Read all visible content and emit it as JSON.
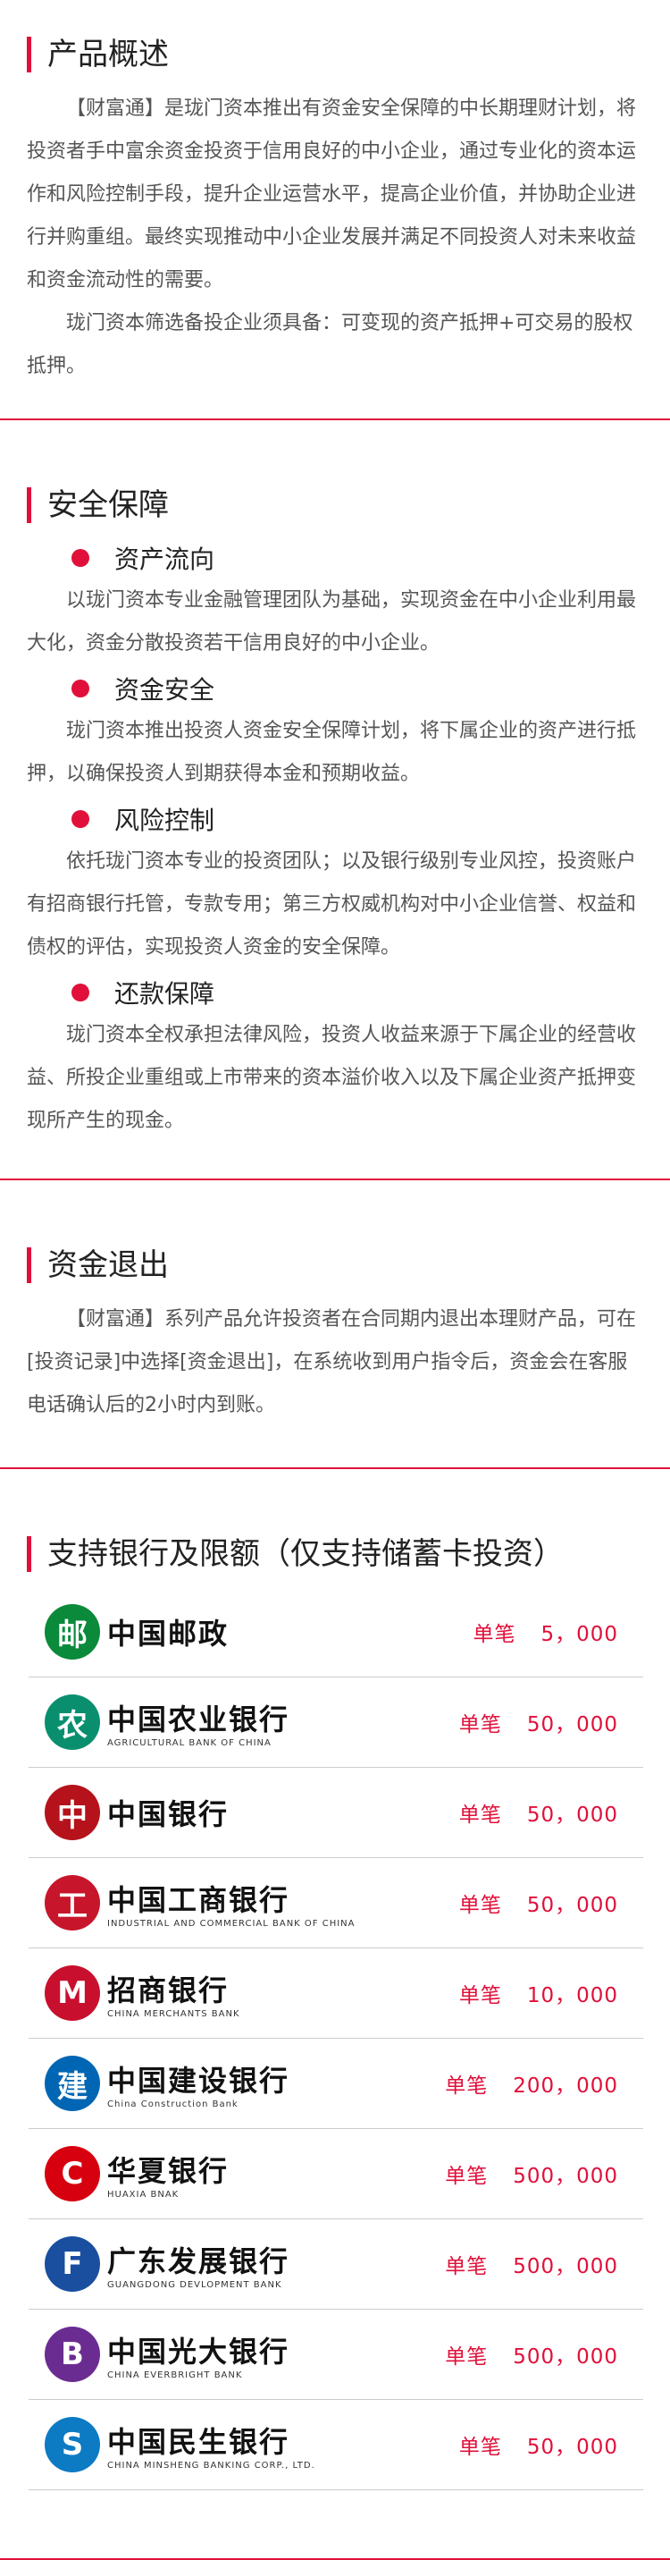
{
  "overview": {
    "title": "产品概述",
    "p1": "【财富通】是珑门资本推出有资金安全保障的中长期理财计划，将投资者手中富余资金投资于信用良好的中小企业，通过专业化的资本运作和风险控制手段，提升企业运营水平，提高企业价值，并协助企业进行并购重组。最终实现推动中小企业发展并满足不同投资人对未来收益和资金流动性的需要。",
    "p2": "珑门资本筛选备投企业须具备：可变现的资产抵押+可交易的股权抵押。"
  },
  "security": {
    "title": "安全保障",
    "items": [
      {
        "title": "资产流向",
        "text": "以珑门资本专业金融管理团队为基础，实现资金在中小企业利用最大化，资金分散投资若干信用良好的中小企业。"
      },
      {
        "title": "资金安全",
        "text": "珑门资本推出投资人资金安全保障计划，将下属企业的资产进行抵押，以确保投资人到期获得本金和预期收益。"
      },
      {
        "title": "风险控制",
        "text": "依托珑门资本专业的投资团队；以及银行级别专业风控，投资账户有招商银行托管，专款专用；第三方权威机构对中小企业信誉、权益和债权的评估，实现投资人资金的安全保障。"
      },
      {
        "title": "还款保障",
        "text": "珑门资本全权承担法律风险，投资人收益来源于下属企业的经营收益、所投企业重组或上市带来的资本溢价收入以及下属企业资产抵押变现所产生的现金。"
      }
    ]
  },
  "exit": {
    "title": "资金退出",
    "text": "【财富通】系列产品允许投资者在合同期内退出本理财产品，可在[投资记录]中选择[资金退出]，在系统收到用户指令后，资金会在客服电话确认后的2小时内到账。"
  },
  "banks": {
    "title": "支持银行及限额（仅支持储蓄卡投资）",
    "limit_label": "单笔",
    "list": [
      {
        "cn": "中国邮政",
        "en": "",
        "icon": "邮",
        "color": "#0a8a3a",
        "limit": "5，000"
      },
      {
        "cn": "中国农业银行",
        "en": "AGRICULTURAL BANK OF CHINA",
        "icon": "农",
        "color": "#0a8f6e",
        "limit": "50，000"
      },
      {
        "cn": "中国银行",
        "en": "",
        "icon": "中",
        "color": "#b5121b",
        "limit": "50，000"
      },
      {
        "cn": "中国工商银行",
        "en": "INDUSTRIAL AND COMMERCIAL BANK OF CHINA",
        "icon": "工",
        "color": "#c7162b",
        "limit": "50，000"
      },
      {
        "cn": "招商银行",
        "en": "CHINA MERCHANTS BANK",
        "icon": "M",
        "color": "#c8102e",
        "limit": "10，000"
      },
      {
        "cn": "中国建设银行",
        "en": "China Construction Bank",
        "icon": "建",
        "color": "#0066b3",
        "limit": "200，000"
      },
      {
        "cn": "华夏银行",
        "en": "HUAXIA BNAK",
        "icon": "C",
        "color": "#d7000f",
        "limit": "500，000"
      },
      {
        "cn": "广东发展银行",
        "en": "GUANGDONG DEVLOPMENT BANK",
        "icon": "F",
        "color": "#1a4fa0",
        "limit": "500，000"
      },
      {
        "cn": "中国光大银行",
        "en": "CHINA EVERBRIGHT BANK",
        "icon": "B",
        "color": "#6b2c91",
        "limit": "500，000"
      },
      {
        "cn": "中国民生银行",
        "en": "CHINA MINSHENG BANKING CORP., LTD.",
        "icon": "S",
        "color": "#0d7ac4",
        "limit": "50，000"
      }
    ]
  }
}
